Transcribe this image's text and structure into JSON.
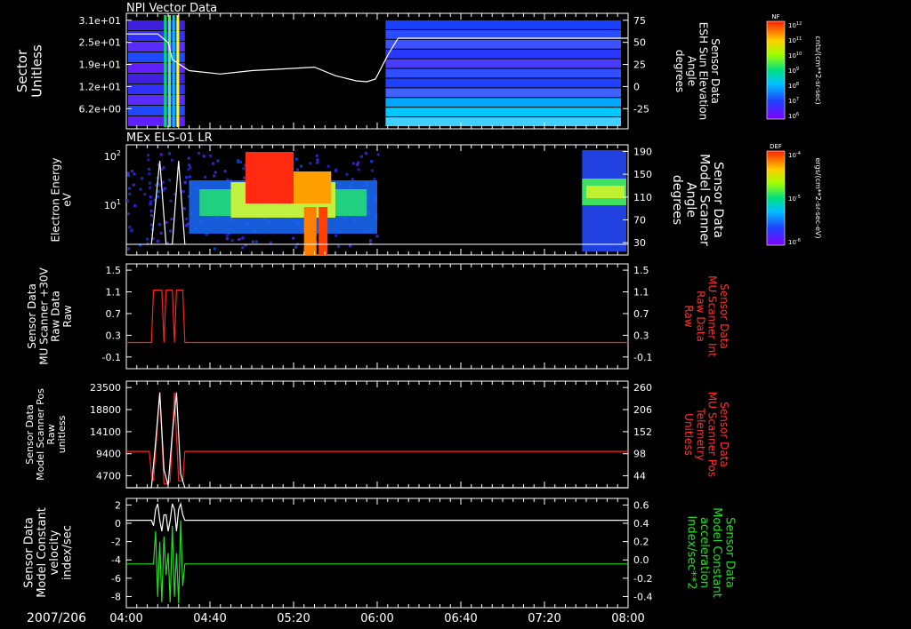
{
  "date_label": "2007/206",
  "time_ticks": [
    "04:00",
    "04:40",
    "05:20",
    "06:00",
    "06:40",
    "07:20",
    "08:00"
  ],
  "colors": {
    "background": "#000000",
    "axes": "#ffffff",
    "trace_white": "#ffffff",
    "trace_red": "#ff2020",
    "trace_green": "#20e020",
    "right_label_red": "#ff3030",
    "right_label_green": "#20e020"
  },
  "chart_data": [
    {
      "type": "heatmap",
      "title": "NPI Vector Data",
      "ylabel": [
        "Sector",
        "Unitless"
      ],
      "y_ticks": [
        "3.1e+01",
        "2.5e+01",
        "1.9e+01",
        "1.2e+01",
        "6.2e+00"
      ],
      "y2label": [
        "Sensor Data",
        "ESH Sun Elevation",
        "Angle",
        "degrees"
      ],
      "y2_ticks": [
        "75",
        "50",
        "25",
        "0",
        "-25"
      ],
      "y2lim": [
        -50,
        75
      ],
      "colorbar": {
        "label": "NF",
        "units": "cnts/(cm**2-sr-sec)",
        "ticks": [
          "10^12",
          "10^11",
          "10^10",
          "10^9",
          "10^8",
          "10^7",
          "10^6"
        ]
      },
      "overlay_series": {
        "name": "Sun elevation",
        "x_minutes": [
          0,
          15,
          20,
          22,
          30,
          45,
          60,
          90,
          100,
          110,
          115,
          119,
          120,
          125,
          130,
          240
        ],
        "values": [
          55,
          55,
          45,
          25,
          12,
          8,
          12,
          16,
          6,
          0,
          -1,
          2,
          6,
          30,
          50,
          50
        ]
      }
    },
    {
      "type": "heatmap",
      "title": "MEx ELS-01 LR",
      "ylabel": [
        "Electron Energy",
        "eV"
      ],
      "y_ticks": [
        "10^2",
        "10^1"
      ],
      "y2label": [
        "Sensor Data",
        "Model Scanner",
        "Angle",
        "degrees"
      ],
      "y2_ticks": [
        "190",
        "150",
        "110",
        "70",
        "30"
      ],
      "y2lim": [
        0,
        190
      ],
      "colorbar": {
        "label": "DEF",
        "units": "ergs/(cm**2-sr-sec-eV)",
        "ticks": [
          "10^-4",
          "10^-5",
          "10^-6"
        ]
      }
    },
    {
      "type": "line",
      "ylabel": [
        "Sensor Data",
        "MU Scanner +30V",
        "Raw Data",
        "Raw"
      ],
      "y_ticks": [
        "1.5",
        "1.1",
        "0.7",
        "0.3",
        "-0.1"
      ],
      "y2label": [
        "Sensor Data",
        "MU Scanner Int",
        "Raw Data",
        "Raw"
      ],
      "y2_ticks": [
        "1.5",
        "1.1",
        "0.7",
        "0.3",
        "-0.1"
      ],
      "ylim": [
        -0.5,
        1.5
      ],
      "series": [
        {
          "color": "red",
          "x_minutes": [
            0,
            12,
            13,
            14,
            17,
            18,
            19,
            20,
            22,
            23,
            24,
            27,
            28,
            240
          ],
          "values": [
            0,
            0,
            1,
            1,
            1,
            0,
            1,
            1,
            1,
            0,
            1,
            1,
            0,
            0
          ]
        }
      ]
    },
    {
      "type": "line",
      "ylabel": [
        "Sensor Data",
        "Model Scanner Pos",
        "Raw",
        "unitless"
      ],
      "y_ticks": [
        "23500",
        "18800",
        "14100",
        "9400",
        "4700"
      ],
      "y2label": [
        "Sensor Data",
        "MU Scanner Pos",
        "Telemetry",
        "Unitless"
      ],
      "y2_ticks": [
        "260",
        "206",
        "152",
        "98",
        "44"
      ],
      "ylim": [
        0,
        23500
      ],
      "series": [
        {
          "color": "red",
          "x_minutes": [
            0,
            11,
            12,
            13,
            16,
            18,
            20,
            21,
            23,
            25,
            27,
            28,
            240
          ],
          "values": [
            8000,
            8000,
            3000,
            1500,
            21000,
            900,
            900,
            1500,
            21000,
            1500,
            1500,
            8000,
            8000
          ]
        },
        {
          "color": "white",
          "x_minutes": [
            0,
            12,
            14,
            16,
            18,
            20,
            22,
            24,
            26,
            28,
            240
          ],
          "values": [
            0,
            0,
            10000,
            21000,
            4000,
            500,
            12000,
            21000,
            3000,
            0,
            0
          ]
        }
      ]
    },
    {
      "type": "line",
      "ylabel": [
        "Sensor Data",
        "Model Constant",
        "velocity",
        "index/sec"
      ],
      "y_ticks": [
        "2",
        "0",
        "-2",
        "-4",
        "-6",
        "-8"
      ],
      "y2label": [
        "Sensor Data",
        "Model Constant",
        "acceleration",
        "Index/sec**2"
      ],
      "y2_ticks": [
        "0.6",
        "0.4",
        "0.2",
        "0.0",
        "-0.2",
        "-0.4"
      ],
      "ylim": [
        -8,
        2
      ],
      "y2lim": [
        -0.4,
        0.6
      ],
      "series": [
        {
          "color": "white",
          "x_minutes": [
            0,
            12,
            13,
            14,
            15,
            16,
            17,
            18,
            19,
            20,
            21,
            22,
            23,
            24,
            25,
            26,
            27,
            28,
            240
          ],
          "values": [
            0,
            0,
            -0.5,
            1,
            1.5,
            0,
            -1,
            0.5,
            0.5,
            -1,
            0,
            1.5,
            1,
            -1,
            1,
            1.5,
            0.5,
            0,
            0
          ]
        },
        {
          "color": "green",
          "x_minutes": [
            0,
            13,
            14,
            15,
            16,
            17,
            18,
            19,
            20,
            21,
            22,
            23,
            24,
            25,
            26,
            27,
            28,
            240
          ],
          "values": [
            0,
            0,
            0.3,
            -0.3,
            0.2,
            -0.35,
            0.25,
            -0.1,
            0.1,
            -0.35,
            0.35,
            -0.3,
            0.1,
            -0.36,
            0.4,
            -0.2,
            0,
            0
          ]
        }
      ]
    }
  ]
}
